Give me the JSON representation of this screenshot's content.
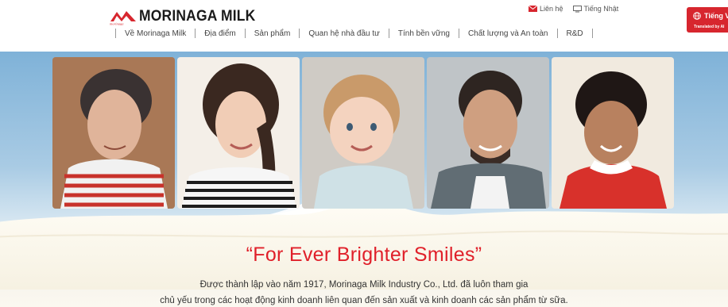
{
  "header": {
    "brand": "MORINAGA MILK",
    "logo_small_text": "morinaga",
    "nav": [
      "Về Morinaga Milk",
      "Địa điểm",
      "Sản phẩm",
      "Quan hệ nhà đầu tư",
      "Tính bền vững",
      "Chất lượng và An toàn",
      "R&D"
    ],
    "contact_label": "Liên hệ",
    "japanese_label": "Tiếng Nhật",
    "lang_button": "Tiếng Việt",
    "lang_button_note": "Translated by AI"
  },
  "hero": {
    "slogan": "“For Ever Brighter Smiles”",
    "desc_line1": "Được thành lập vào năm 1917, Morinaga Milk Industry Co., Ltd. đã luôn tham gia",
    "desc_line2": "chủ yếu trong các hoạt động kinh doanh liên quan đến sản xuất và kinh doanh các sản phẩm từ sữa."
  },
  "colors": {
    "brand_red": "#d7262e",
    "slogan_red": "#e0202a"
  },
  "icons": {
    "contact": "envelope-icon",
    "japanese": "monitor-icon",
    "language": "globe-icon"
  }
}
